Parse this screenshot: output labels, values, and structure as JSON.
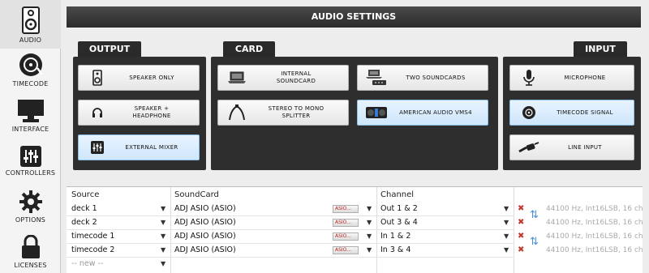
{
  "sidebar": {
    "items": [
      {
        "label": "AUDIO",
        "icon": "speaker-icon"
      },
      {
        "label": "TIMECODE",
        "icon": "vinyl-icon"
      },
      {
        "label": "INTERFACE",
        "icon": "monitor-icon"
      },
      {
        "label": "CONTROLLERS",
        "icon": "sliders-icon"
      },
      {
        "label": "OPTIONS",
        "icon": "gear-icon"
      },
      {
        "label": "LICENSES",
        "icon": "lock-icon"
      }
    ]
  },
  "title": "AUDIO SETTINGS",
  "output": {
    "tab": "OUTPUT",
    "buttons": [
      {
        "label": "SPEAKER ONLY"
      },
      {
        "label": "SPEAKER +\nHEADPHONE"
      },
      {
        "label": "EXTERNAL MIXER"
      }
    ]
  },
  "card": {
    "tab": "CARD",
    "buttons": [
      {
        "label": "INTERNAL\nSOUNDCARD"
      },
      {
        "label": "TWO SOUNDCARDS"
      },
      {
        "label": "STEREO TO MONO\nSPLITTER"
      },
      {
        "label": "AMERICAN AUDIO VMS4"
      }
    ]
  },
  "input": {
    "tab": "INPUT",
    "buttons": [
      {
        "label": "MICROPHONE"
      },
      {
        "label": "TIMECODE SIGNAL"
      },
      {
        "label": "LINE INPUT"
      }
    ]
  },
  "table": {
    "headers": {
      "source": "Source",
      "soundcard": "SoundCard",
      "channel": "Channel"
    },
    "rows": [
      {
        "source": "deck 1",
        "soundcard": "ADJ ASIO (ASIO)",
        "asio": "ASIO...",
        "channel": "Out 1 & 2",
        "format": "44100 Hz, Int16LSB, 16 ch"
      },
      {
        "source": "deck 2",
        "soundcard": "ADJ ASIO (ASIO)",
        "asio": "ASIO...",
        "channel": "Out 3 & 4",
        "format": "44100 Hz, Int16LSB, 16 ch"
      },
      {
        "source": "timecode 1",
        "soundcard": "ADJ ASIO (ASIO)",
        "asio": "ASIO...",
        "channel": "In 1 & 2",
        "format": "44100 Hz, Int16LSB, 16 ch"
      },
      {
        "source": "timecode 2",
        "soundcard": "ADJ ASIO (ASIO)",
        "asio": "ASIO...",
        "channel": "In 3 & 4",
        "format": "44100 Hz, Int16LSB, 16 ch"
      }
    ],
    "new_row": "-- new --"
  }
}
